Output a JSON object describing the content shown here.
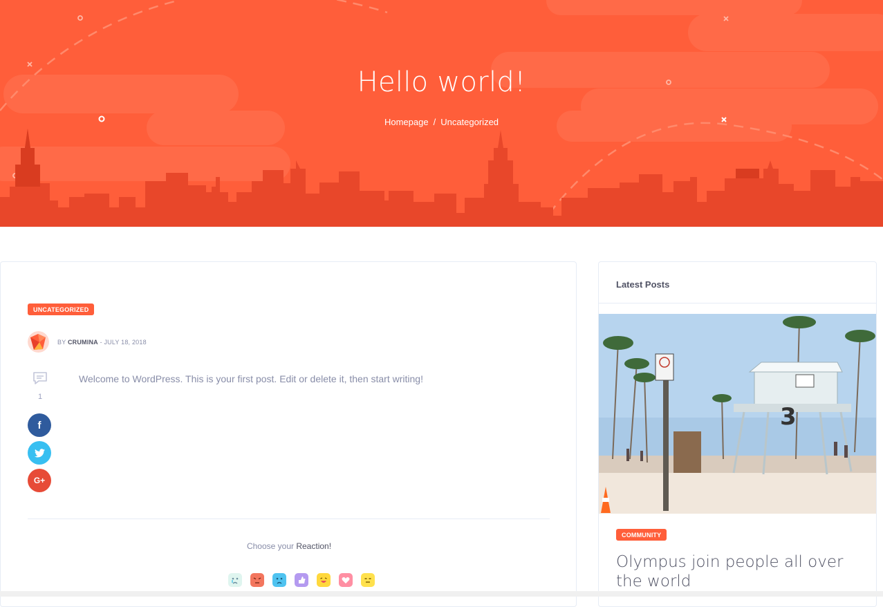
{
  "hero": {
    "title": "Hello world!",
    "breadcrumb": {
      "home": "Homepage",
      "separator": "/",
      "current": "Uncategorized"
    },
    "bg_color": "#ff5e3a"
  },
  "post": {
    "category": "UNCATEGORIZED",
    "author_prefix": "BY",
    "author": "CRUMINA",
    "date_sep": "-",
    "date": "JULY 18, 2018",
    "comment_count": "1",
    "text": "Welcome to WordPress. This is your first post. Edit or delete it, then start writing!",
    "share": [
      {
        "name": "facebook",
        "glyph": "f",
        "color": "#2f5b9d"
      },
      {
        "name": "twitter",
        "glyph": "t",
        "color": "#38bff1"
      },
      {
        "name": "google-plus",
        "glyph": "G+",
        "color": "#e74b37"
      }
    ],
    "reaction_prefix": "Choose your",
    "reaction_word": "Reaction!",
    "reactions": [
      "cry-icon",
      "angry-icon",
      "sad-icon",
      "like-icon",
      "lol-icon",
      "love-icon",
      "meh-icon"
    ]
  },
  "sidebar": {
    "title": "Latest Posts",
    "post": {
      "category": "COMMUNITY",
      "title": "Olympus join people all over the world"
    }
  },
  "colors": {
    "accent": "#ff5e3a",
    "text_muted": "#888da8",
    "text_dark": "#515365",
    "border": "#e6ecf5"
  }
}
